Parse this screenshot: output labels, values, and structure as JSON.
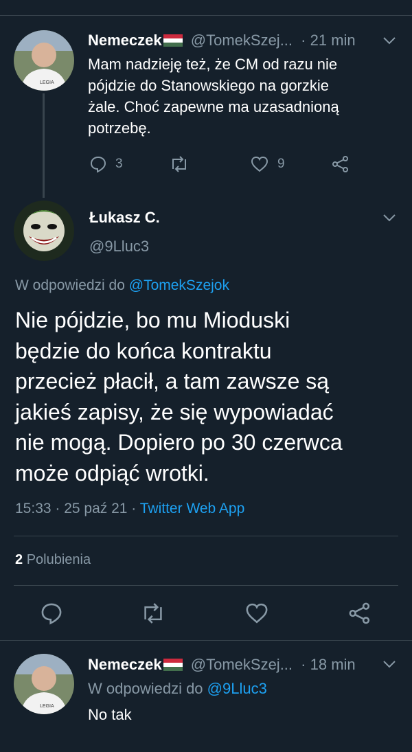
{
  "colors": {
    "background": "#15202b",
    "muted": "#8899a6",
    "link": "#1da1f2",
    "divider": "#38444d"
  },
  "tweet1": {
    "display_name": "Nemeczek",
    "handle": "@TomekSzej...",
    "separator": "·",
    "time": "21 min",
    "text_lines": [
      "Mam nadzieję też, że CM od razu nie",
      "pójdzie do Stanowskiego na gorzkie",
      "żale. Choć zapewne ma uzasadnioną",
      "potrzebę."
    ],
    "reply_count": "3",
    "like_count": "9"
  },
  "main_tweet": {
    "display_name": "Łukasz C.",
    "handle": "@9Lluc3",
    "reply_prefix": "W odpowiedzi do",
    "reply_to": "@TomekSzejok",
    "text_lines": [
      "Nie pójdzie, bo mu Mioduski",
      "będzie do końca kontraktu",
      "przecież płacił, a tam zawsze są",
      "jakieś zapisy, że się wypowiadać",
      "nie mogą. Dopiero po 30 czerwca",
      "może odpiąć wrotki."
    ],
    "timestamp": "15:33 · 25 paź 21 ·",
    "source": "Twitter Web App",
    "likes_count": "2",
    "likes_label": "Polubienia"
  },
  "tweet3": {
    "display_name": "Nemeczek",
    "handle": "@TomekSzej...",
    "separator": "·",
    "time": "18 min",
    "reply_prefix": "W odpowiedzi do",
    "reply_to": "@9Lluc3",
    "text": "No tak"
  },
  "icons": {
    "reply": "reply-icon",
    "retweet": "retweet-icon",
    "like": "heart-icon",
    "share": "share-icon",
    "menu": "chevron-down-icon",
    "flag": "hungary-flag-icon"
  }
}
